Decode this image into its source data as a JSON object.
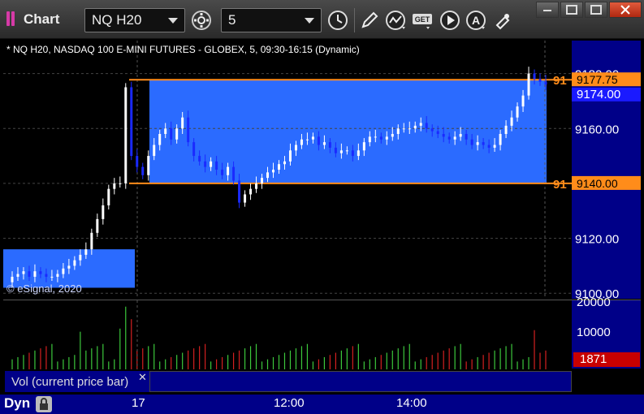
{
  "toolbar": {
    "title": "Chart",
    "symbol": "NQ H20",
    "interval": "5",
    "icons": [
      "gear-icon",
      "clock-icon",
      "pencil-icon",
      "study-icon",
      "get-icon",
      "play-icon",
      "alert-icon",
      "pan-icon"
    ]
  },
  "window": {
    "buttons": [
      "restore-icon",
      "maximize-icon",
      "close-icon"
    ]
  },
  "chart": {
    "header": "* NQ H20, NASDAQ 100 E-MINI FUTURES - GLOBEX, 5, 09:30-16:15 (Dynamic)",
    "copyright": "© eSignal, 2020",
    "colors": {
      "up": "#ffffff",
      "down": "#1a2aff",
      "zone": "#2b6bff",
      "line": "#ff8c1a",
      "axis_bg": "#000088"
    }
  },
  "chart_data": {
    "type": "candlestick",
    "ylim": [
      9098,
      9192
    ],
    "yticks": [
      9100,
      9120,
      9140,
      9160,
      9180
    ],
    "ytick_labels": [
      "9100.00",
      "9120.00",
      "9140.00",
      "9160.00",
      "9180.00"
    ],
    "x_tick_labels": [
      "17",
      "12:00",
      "14:00"
    ],
    "zones": [
      {
        "from": 9102,
        "to": 9116
      },
      {
        "from": 9140,
        "to": 9177.75
      }
    ],
    "level_lines": [
      {
        "value": 9177.75,
        "label": "9177.75",
        "short": "91"
      },
      {
        "value": 9140.0,
        "label": "9140.00",
        "short": "91"
      }
    ],
    "last_price": "9174.00",
    "volume": {
      "ylim": [
        0,
        22000
      ],
      "yticks": [
        "20000",
        "10000"
      ],
      "last": "1871",
      "series_label": "Vol (current price bar)"
    }
  },
  "status": {
    "dyn_label": "Dyn"
  }
}
